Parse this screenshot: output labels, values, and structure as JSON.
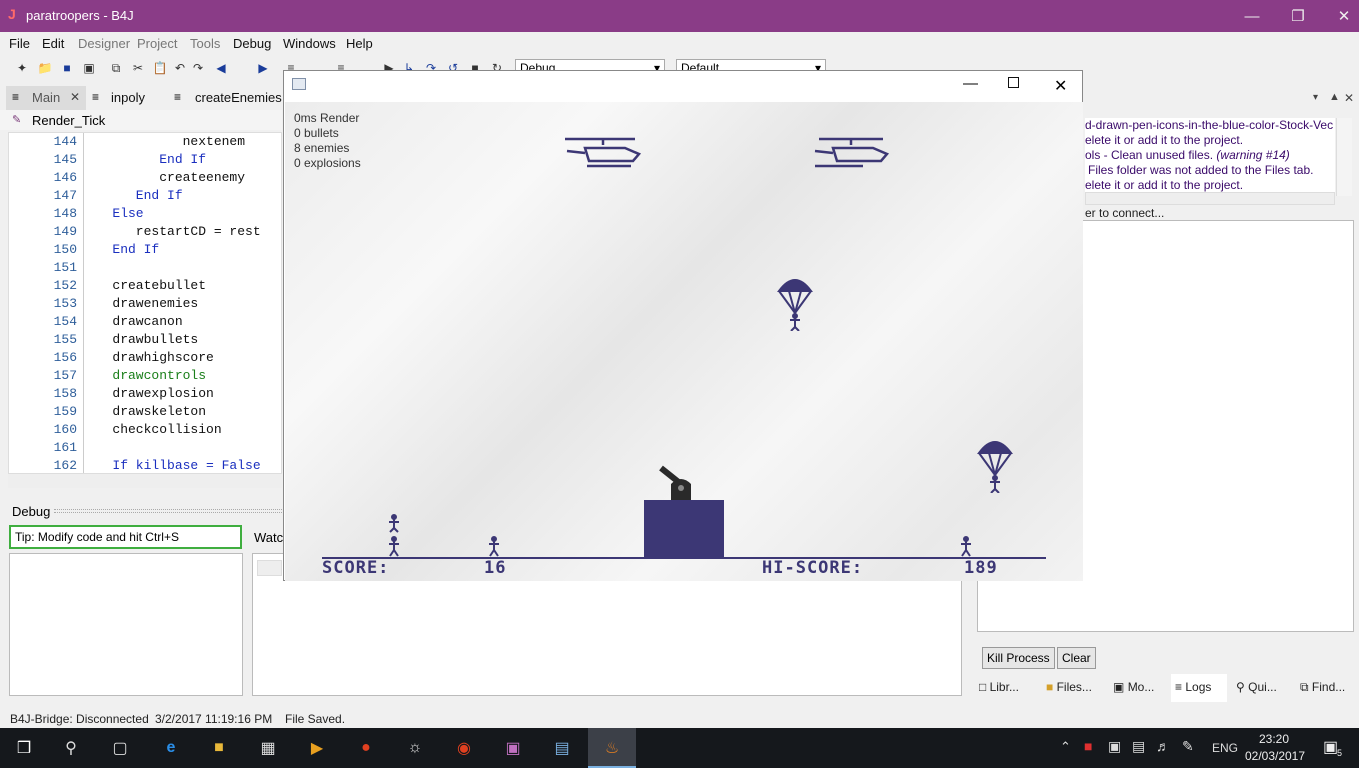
{
  "window": {
    "title": "paratroopers - B4J",
    "logo": "J"
  },
  "menu": [
    "File",
    "Edit",
    "Designer",
    "Project",
    "Tools",
    "Debug",
    "Windows",
    "Help"
  ],
  "toolbar": {
    "mode": "Debug",
    "config": "Default"
  },
  "tabs": [
    "Main",
    "inpoly",
    "createEnemies"
  ],
  "module": "Render_Tick",
  "code": [
    {
      "n": "144",
      "t": "            nextenem"
    },
    {
      "n": "145",
      "t": "         End If"
    },
    {
      "n": "146",
      "t": "         createenemy"
    },
    {
      "n": "147",
      "t": "      End If"
    },
    {
      "n": "148",
      "t": "   Else"
    },
    {
      "n": "149",
      "t": "      restartCD = rest"
    },
    {
      "n": "150",
      "t": "   End If"
    },
    {
      "n": "151",
      "t": ""
    },
    {
      "n": "152",
      "t": "   createbullet"
    },
    {
      "n": "153",
      "t": "   drawenemies"
    },
    {
      "n": "154",
      "t": "   drawcanon"
    },
    {
      "n": "155",
      "t": "   drawbullets"
    },
    {
      "n": "156",
      "t": "   drawhighscore"
    },
    {
      "n": "157",
      "t": "   drawcontrols"
    },
    {
      "n": "158",
      "t": "   drawexplosion"
    },
    {
      "n": "159",
      "t": "   drawskeleton"
    },
    {
      "n": "160",
      "t": "   checkcollision"
    },
    {
      "n": "161",
      "t": ""
    },
    {
      "n": "162",
      "t": "   If killbase = False"
    }
  ],
  "debug": {
    "label": "Debug",
    "tip": "Tip: Modify code and hit Ctrl+S",
    "watch_label": "Watc"
  },
  "logs": {
    "lines": [
      "d-drawn-pen-icons-in-the-blue-color-Stock-Vec",
      "elete it or add it to the project.",
      "ols - Clean unused files.",
      "Files folder was not added to the Files tab.",
      "elete it or add it to the project."
    ],
    "warning": "(warning #14)",
    "connect": "er to connect..."
  },
  "buttons": {
    "kill": "Kill Process",
    "clear": "Clear"
  },
  "bottom_tabs": [
    "Libr...",
    "Files...",
    "Mo...",
    "Logs",
    "Qui...",
    "Find..."
  ],
  "status": {
    "bridge": "B4J-Bridge: Disconnected",
    "time": "3/2/2017 11:19:16 PM",
    "saved": "File Saved."
  },
  "game": {
    "stats": [
      "0ms Render",
      "0 bullets",
      "8 enemies",
      "0 explosions"
    ],
    "score_label": "SCORE:",
    "score": "16",
    "hiscore_label": "HI-SCORE:",
    "hiscore": "189"
  },
  "taskbar": {
    "time": "23:20",
    "date": "02/03/2017",
    "lang": "ENG",
    "notifications": "5"
  },
  "colors": {
    "titlebar": "#8a3c87",
    "game_ink": "#3c3775",
    "accent_green": "#3fae3f"
  }
}
